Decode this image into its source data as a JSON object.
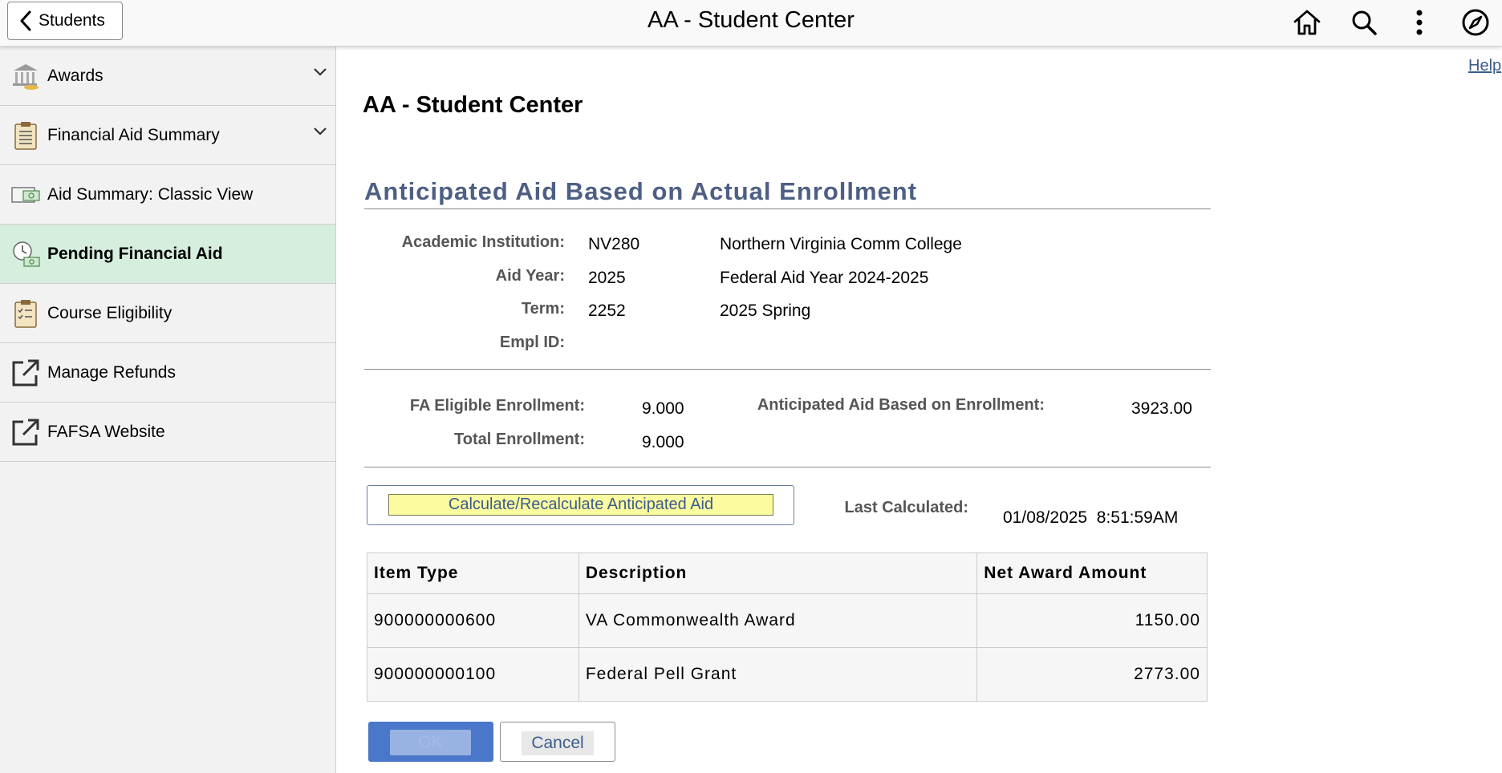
{
  "header": {
    "back_label": "Students",
    "title": "AA - Student Center",
    "icons": [
      "home-icon",
      "search-icon",
      "more-vert-icon",
      "compass-icon"
    ]
  },
  "sidebar": {
    "items": [
      {
        "label": "Awards",
        "icon": "bank-icon",
        "expandable": true,
        "active": false
      },
      {
        "label": "Financial Aid Summary",
        "icon": "clipboard-list-icon",
        "expandable": true,
        "active": false
      },
      {
        "label": "Aid Summary: Classic View",
        "icon": "money-monitor-icon",
        "expandable": false,
        "active": false
      },
      {
        "label": "Pending Financial Aid",
        "icon": "clock-money-icon",
        "expandable": false,
        "active": true
      },
      {
        "label": "Course Eligibility",
        "icon": "clipboard-check-icon",
        "expandable": false,
        "active": false
      },
      {
        "label": "Manage Refunds",
        "icon": "external-link-icon",
        "expandable": false,
        "active": false
      },
      {
        "label": "FAFSA Website",
        "icon": "external-link-icon",
        "expandable": false,
        "active": false
      }
    ],
    "active_color": "#d6eedd"
  },
  "main": {
    "help": "Help",
    "page_title": "AA - Student Center",
    "section_title": "Anticipated Aid Based on Actual Enrollment",
    "info": {
      "institution_label": "Academic Institution:",
      "institution_code": "NV280",
      "institution_name": "Northern Virginia Comm College",
      "aid_year_label": "Aid Year:",
      "aid_year_code": "2025",
      "aid_year_name": "Federal Aid Year 2024-2025",
      "term_label": "Term:",
      "term_code": "2252",
      "term_name": "2025 Spring",
      "empl_label": "Empl ID:"
    },
    "enrollment": {
      "fa_eligible_label": "FA Eligible Enrollment:",
      "fa_eligible_value": "9.000",
      "total_label": "Total Enrollment:",
      "total_value": "9.000",
      "anticipated_label": "Anticipated Aid Based on Enrollment:",
      "anticipated_value": "3923.00"
    },
    "calc_button": "Calculate/Recalculate Anticipated Aid",
    "last_calc_label": "Last Calculated:",
    "last_calc_value": "01/08/2025  8:51:59AM",
    "table": {
      "headers": [
        "Item Type",
        "Description",
        "Net Award Amount"
      ],
      "rows": [
        [
          "900000000600",
          "VA Commonwealth Award",
          "1150.00"
        ],
        [
          "900000000100",
          "Federal Pell Grant",
          "2773.00"
        ]
      ]
    },
    "ok_label": "OK",
    "cancel_label": "Cancel"
  }
}
